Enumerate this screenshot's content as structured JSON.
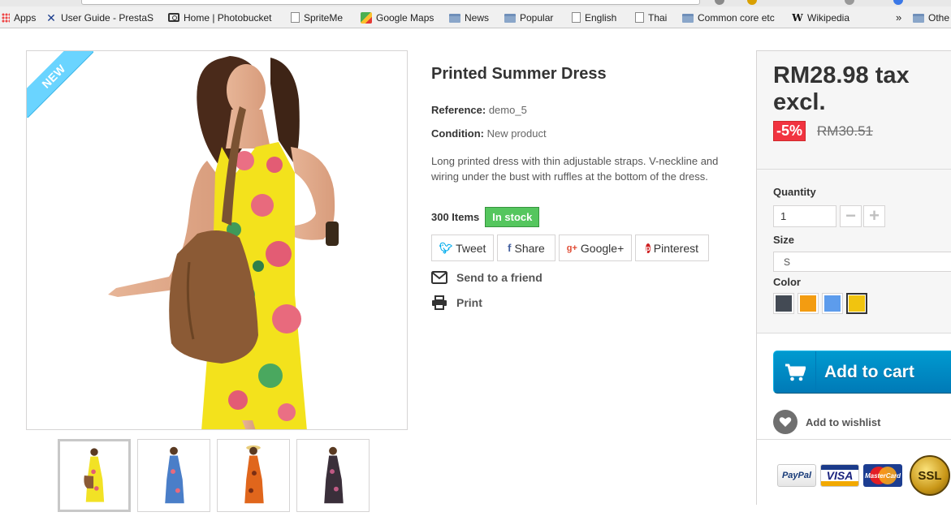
{
  "browser": {
    "bookmarks": [
      {
        "label": "Apps",
        "icon": "apps-grid-icon"
      },
      {
        "label": "User Guide - PrestaS",
        "icon": "prestashop-x-icon"
      },
      {
        "label": "Home | Photobucket",
        "icon": "camera-icon"
      },
      {
        "label": "SpriteMe",
        "icon": "page-icon"
      },
      {
        "label": "Google Maps",
        "icon": "google-maps-icon"
      },
      {
        "label": "News",
        "icon": "folder-icon"
      },
      {
        "label": "Popular",
        "icon": "folder-icon"
      },
      {
        "label": "English",
        "icon": "page-icon"
      },
      {
        "label": "Thai",
        "icon": "page-icon"
      },
      {
        "label": "Common core etc",
        "icon": "folder-icon"
      },
      {
        "label": "Wikipedia",
        "icon": "wikipedia-icon"
      }
    ],
    "overflow_label": "»",
    "other_bookmarks_label": "Othe"
  },
  "gallery": {
    "new_label": "NEW",
    "thumbnails": [
      {
        "name": "yellow-dress",
        "dress_color": "#f2e225",
        "active": true
      },
      {
        "name": "blue-dress",
        "dress_color": "#4a7ec8",
        "active": false
      },
      {
        "name": "orange-dress",
        "dress_color": "#e0661c",
        "active": false
      },
      {
        "name": "black-dress",
        "dress_color": "#3a2f3a",
        "active": false
      }
    ]
  },
  "product": {
    "title": "Printed Summer Dress",
    "reference_label": "Reference:",
    "reference_value": "demo_5",
    "condition_label": "Condition:",
    "condition_value": "New product",
    "description": "Long printed dress with thin adjustable straps. V-neckline and wiring under the bust with ruffles at the bottom of the dress.",
    "items_count": "300 Items",
    "stock_status": "In stock",
    "social": [
      {
        "label": "Tweet",
        "icon": "twitter-icon"
      },
      {
        "label": "Share",
        "icon": "facebook-icon"
      },
      {
        "label": "Google+",
        "icon": "google-plus-icon"
      },
      {
        "label": "Pinterest",
        "icon": "pinterest-icon"
      }
    ],
    "send_to_friend": "Send to a friend",
    "print": "Print"
  },
  "buy": {
    "price": "RM28.98 tax excl.",
    "discount": "-5%",
    "old_price": "RM30.51",
    "quantity_label": "Quantity",
    "quantity_value": "1",
    "minus": "−",
    "plus": "+",
    "size_label": "Size",
    "size_value": "S",
    "color_label": "Color",
    "colors": [
      {
        "name": "dark-gray",
        "hex": "#434a54",
        "selected": false
      },
      {
        "name": "orange",
        "hex": "#f39c11",
        "selected": false
      },
      {
        "name": "blue",
        "hex": "#5d9cec",
        "selected": false
      },
      {
        "name": "yellow",
        "hex": "#f1c40f",
        "selected": true
      }
    ],
    "add_to_cart": "Add to cart",
    "wishlist": "Add to wishlist",
    "payments": [
      "PayPal",
      "VISA",
      "MasterCard",
      "SSL"
    ]
  },
  "colors": {
    "ribbon": "#6ad4ff",
    "in_stock": "#55c65e",
    "discount": "#f13340",
    "cart_button": "#0088c5"
  }
}
